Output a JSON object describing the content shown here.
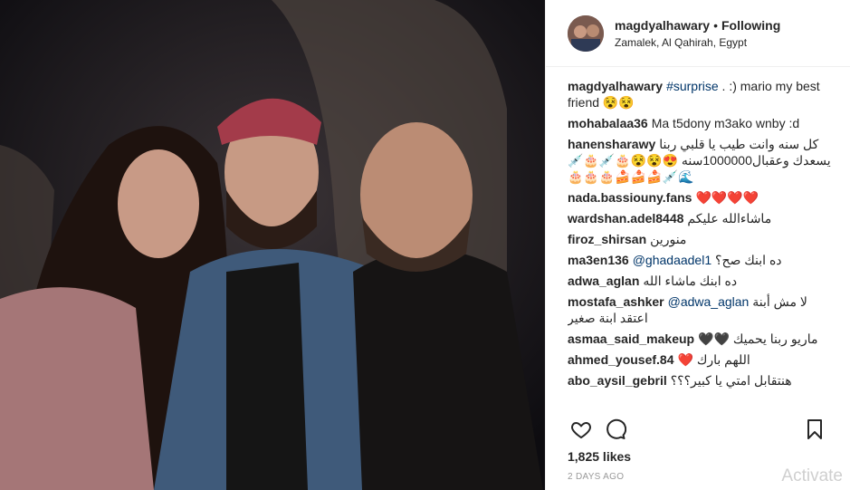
{
  "post": {
    "username": "magdyalhawary",
    "separator": "•",
    "follow_status": "Following",
    "location": "Zamalek, Al Qahirah, Egypt"
  },
  "comments": [
    {
      "user": "magdyalhawary",
      "pre": "",
      "link": "#surprise",
      "text": ". :) mario my best friend 😵😵",
      "rtl": false
    },
    {
      "user": "mohabalaa36",
      "pre": "",
      "link": "",
      "text": "Ma t5dony m3ako wnby :d",
      "rtl": false
    },
    {
      "user": "hanensharawy",
      "pre": "",
      "link": "",
      "text": "كل سنه وانت طيب يا قلبي ربنا يسعدك وعقبال1000000سنه 😍😵😵🎂💉🎂💉🌊💉🍰🍰🍰🎂🎂🎂",
      "rtl": true
    },
    {
      "user": "nada.bassiouny.fans",
      "pre": "",
      "link": "",
      "text": "❤️❤️❤️❤️",
      "rtl": false
    },
    {
      "user": "wardshan.adel8448",
      "pre": "",
      "link": "",
      "text": "ماشاءالله عليكم",
      "rtl": true
    },
    {
      "user": "firoz_shirsan",
      "pre": "",
      "link": "",
      "text": "منورين",
      "rtl": true
    },
    {
      "user": "ma3en136",
      "pre": "",
      "link": "@ghadaadel1",
      "text": "ده ابنك صح؟",
      "rtl": false
    },
    {
      "user": "adwa_aglan",
      "pre": "",
      "link": "",
      "text": "ده ابنك ماشاء الله",
      "rtl": true
    },
    {
      "user": "mostafa_ashker",
      "pre": "",
      "link": "@adwa_aglan",
      "text": "لا مش أبنة اعتقد ابنة صغير",
      "rtl": false
    },
    {
      "user": "asmaa_said_makeup",
      "pre": "",
      "link": "",
      "text": "ماريو ربنا يحميك 🖤🖤",
      "rtl": true
    },
    {
      "user": "ahmed_yousef.84",
      "pre": "",
      "link": "",
      "text": "اللهم بارك ❤️",
      "rtl": true
    },
    {
      "user": "abo_aysil_gebril",
      "pre": "",
      "link": "",
      "text": "هنتقابل امتي يا كبير؟؟؟",
      "rtl": true
    }
  ],
  "actions": {
    "like_icon": "heart-icon",
    "comment_icon": "comment-icon",
    "save_icon": "bookmark-icon"
  },
  "likes": "1,825 likes",
  "time": "2 DAYS AGO",
  "watermark": "Activate"
}
